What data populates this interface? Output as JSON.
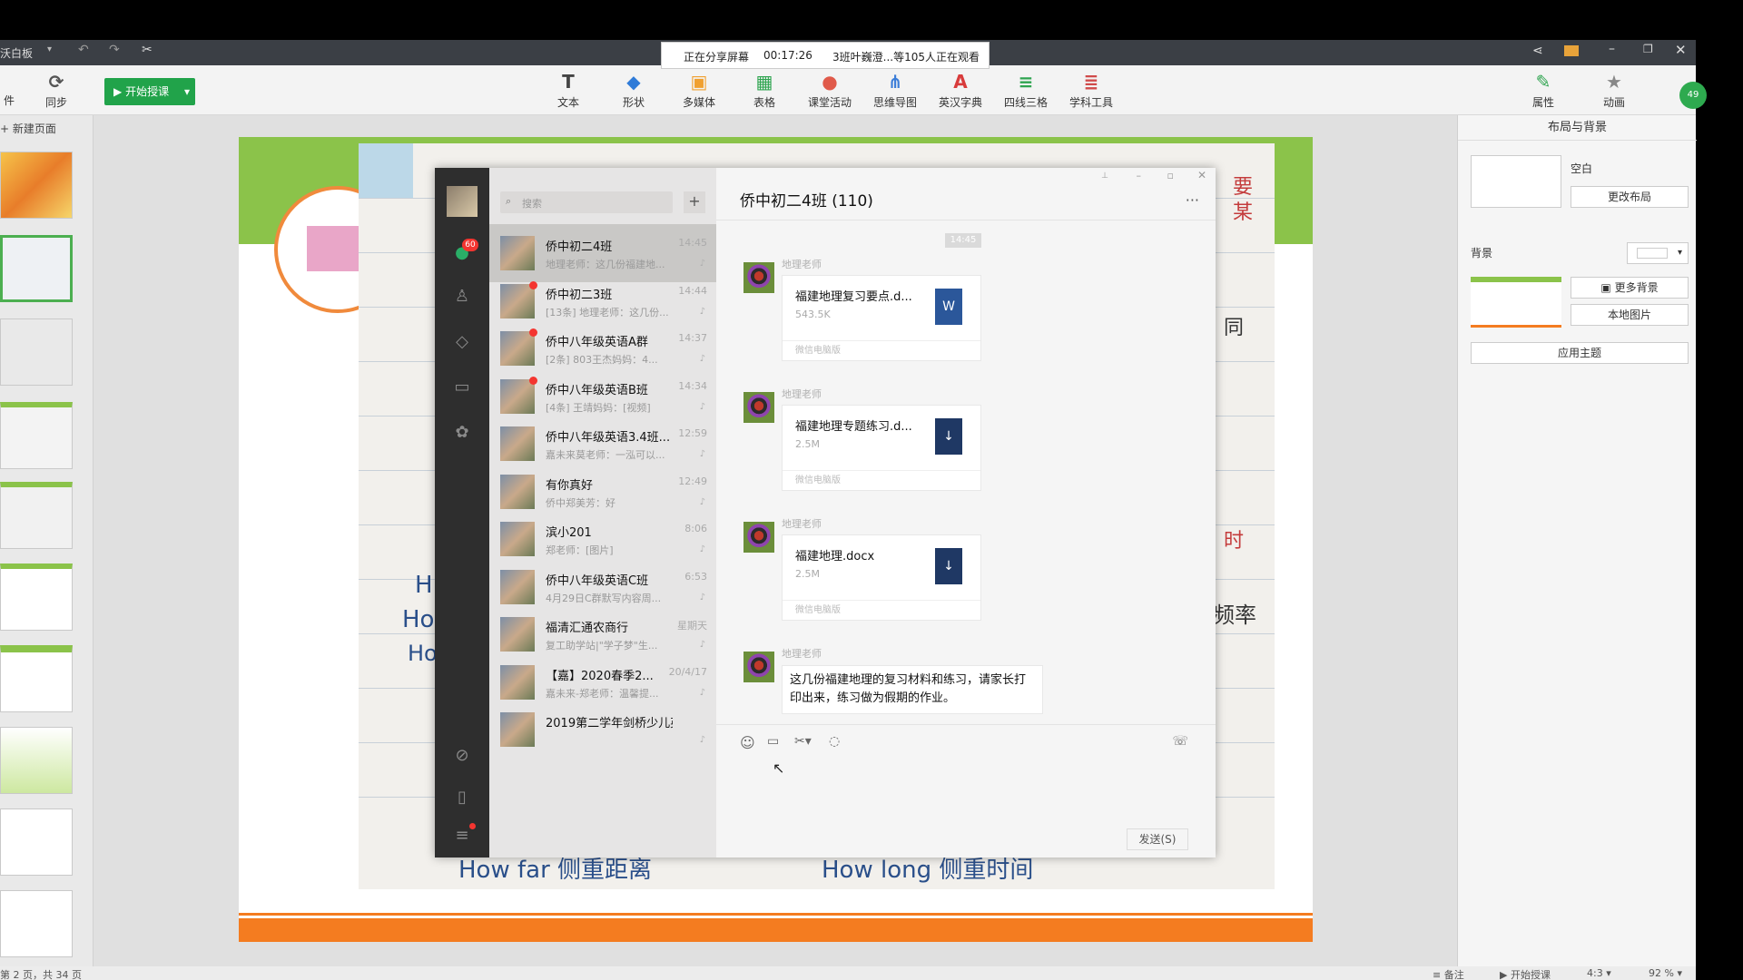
{
  "app": {
    "title_left": "沃白板",
    "sync_label": "同步",
    "start_class": "开始授课",
    "new_page": "新建页面"
  },
  "share": {
    "status": "正在分享屏幕",
    "timer": "00:17:26",
    "viewers": "3班叶巍澄...等105人正在观看"
  },
  "toolbar": {
    "tools": [
      "文本",
      "形状",
      "多媒体",
      "表格",
      "课堂活动",
      "思维导图",
      "英汉字典",
      "四线三格",
      "学科工具"
    ],
    "right": [
      "属性",
      "动画"
    ],
    "badge": "49"
  },
  "right_panel": {
    "title": "布局与背景",
    "layout_label": "空白",
    "change_layout": "更改布局",
    "background_label": "背景",
    "more_bg": "更多背景",
    "local_image": "本地图片",
    "apply_theme": "应用主题"
  },
  "wechat": {
    "search_placeholder": "搜索",
    "unread_badge": "60",
    "chat_title": "侨中初二4班 (110)",
    "conversations": [
      {
        "name": "侨中初二4班",
        "time": "14:45",
        "snippet": "地理老师：这几份福建地..."
      },
      {
        "name": "侨中初二3班",
        "time": "14:44",
        "snippet": "[13条] 地理老师：这几份..."
      },
      {
        "name": "侨中八年级英语A群",
        "time": "14:37",
        "snippet": "[2条] 803王杰妈妈：4..."
      },
      {
        "name": "侨中八年级英语B班",
        "time": "14:34",
        "snippet": "[4条] 王靖妈妈：[视频]"
      },
      {
        "name": "侨中八年级英语3.4班...",
        "time": "12:59",
        "snippet": "嘉未来莫老师：一泓可以..."
      },
      {
        "name": "有你真好",
        "time": "12:49",
        "snippet": "侨中郑美芳：好"
      },
      {
        "name": "滨小201",
        "time": "8:06",
        "snippet": "郑老师：[图片]"
      },
      {
        "name": "侨中八年级英语C班",
        "time": "6:53",
        "snippet": "4月29日C群默写内容周..."
      },
      {
        "name": "福清汇通农商行",
        "time": "星期天",
        "snippet": "复工助学站|\"学子梦\"生..."
      },
      {
        "name": "【嘉】2020春季2...",
        "time": "20/4/17",
        "snippet": "嘉未来-郑老师：温馨提..."
      },
      {
        "name": "2019第二学年剑桥少儿英...",
        "time": "",
        "snippet": ""
      }
    ],
    "time_divider": "14:45",
    "sender": "地理老师",
    "files": [
      {
        "name": "福建地理复习要点.d...",
        "size": "543.5K",
        "source": "微信电脑版",
        "icon": "W"
      },
      {
        "name": "福建地理专题练习.d...",
        "size": "2.5M",
        "source": "微信电脑版",
        "icon": "↓"
      },
      {
        "name": "福建地理.docx",
        "size": "2.5M",
        "source": "微信电脑版",
        "icon": "↓"
      }
    ],
    "text_message": "这几份福建地理的复习材料和练习，请家长打印出来，练习做为假期的作业。",
    "send_button": "发送(S)"
  },
  "status": {
    "page_info": "第 2 页，共 34 页",
    "notes": "备注",
    "start": "开始授课",
    "ratio": "4:3",
    "zoom": "92 %"
  },
  "photo_text": {
    "right_chars": [
      "要",
      "某",
      "同",
      "时",
      "频率"
    ],
    "bottom_left": "How far 侧重距离",
    "bottom_right": "How long 侧重时间",
    "left_chars": [
      "H",
      "Ho",
      "Ho"
    ]
  }
}
